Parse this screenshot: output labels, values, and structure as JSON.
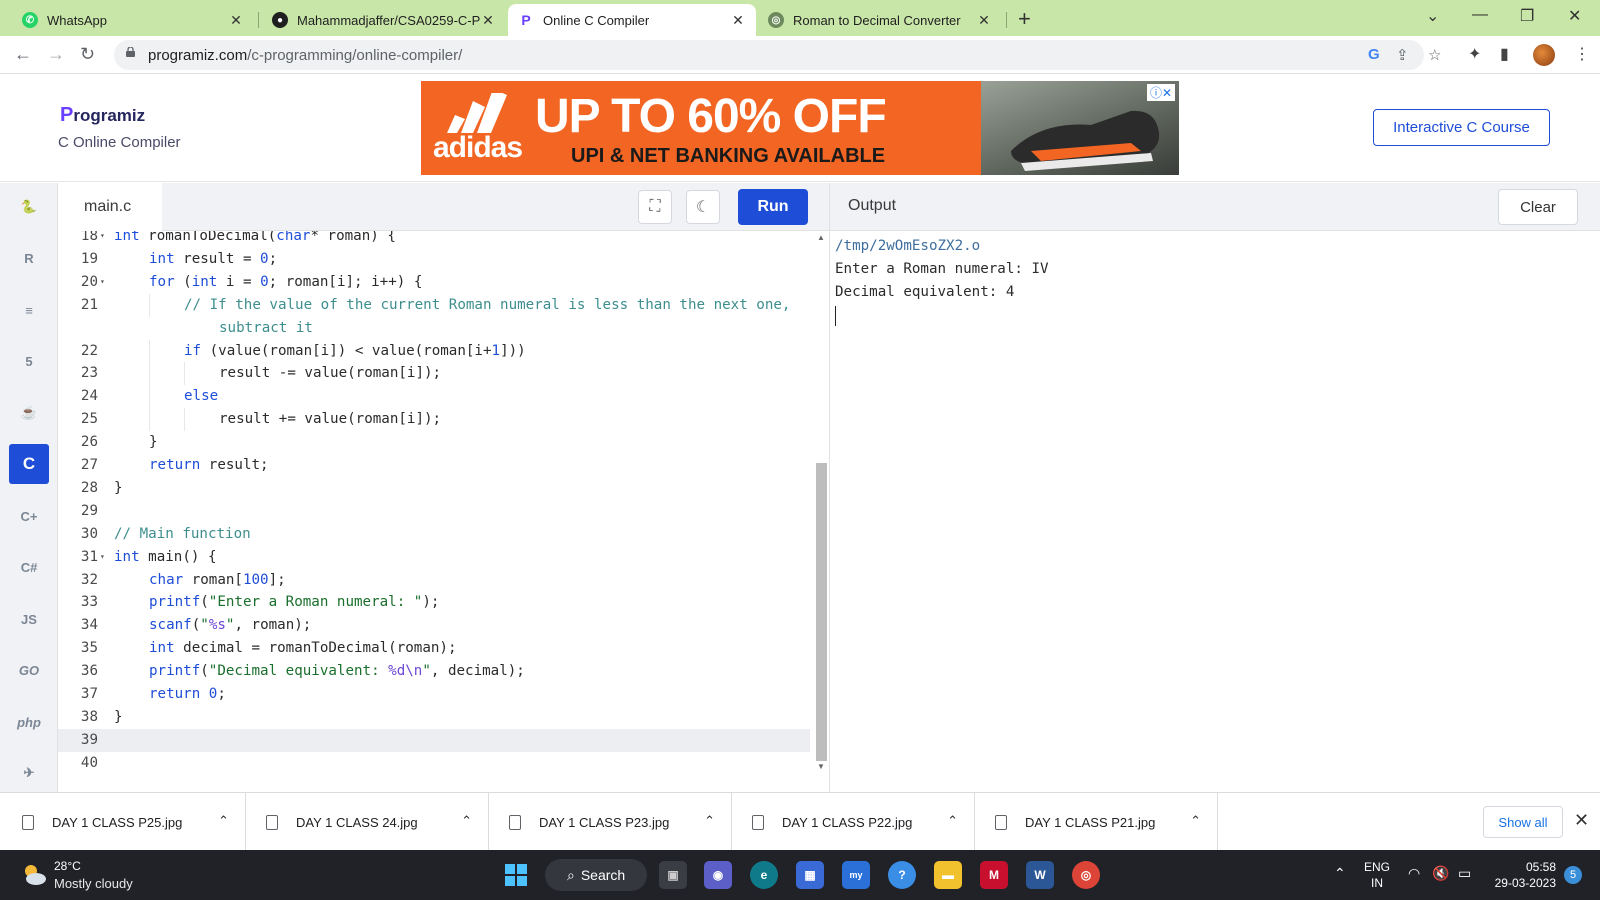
{
  "browser": {
    "tabs": [
      {
        "label": "WhatsApp",
        "icon": "whatsapp-icon",
        "color": "#25d366"
      },
      {
        "label": "Mahammadjaffer/CSA0259-C-PR",
        "icon": "github-icon",
        "color": "#1f1f1f"
      },
      {
        "label": "Online C Compiler",
        "icon": "programiz-icon",
        "color": "#6a3fff"
      },
      {
        "label": "Roman to Decimal Converter",
        "icon": "globe-icon",
        "color": "#6c8a5c"
      }
    ],
    "url_host": "programiz.com",
    "url_path": "/c-programming/online-compiler/"
  },
  "site": {
    "logo_text": "rogramiz",
    "logo_p": "P",
    "subtitle": "C Online Compiler",
    "course_button": "Interactive C Course",
    "ad": {
      "brand": "adidas",
      "headline": "UP TO 60% OFF",
      "subline": "UPI & NET BANKING AVAILABLE",
      "badge": "ⓘ✕",
      "color": "#f26522"
    }
  },
  "sidebar": {
    "items": [
      {
        "icon": "python-icon",
        "label": "🐍"
      },
      {
        "icon": "r-icon",
        "label": "R"
      },
      {
        "icon": "sql-icon",
        "label": "≡"
      },
      {
        "icon": "html5-icon",
        "label": "5"
      },
      {
        "icon": "java-icon",
        "label": "☕"
      },
      {
        "icon": "c-icon",
        "label": "C"
      },
      {
        "icon": "cpp-icon",
        "label": "C+"
      },
      {
        "icon": "csharp-icon",
        "label": "C#"
      },
      {
        "icon": "js-icon",
        "label": "JS"
      },
      {
        "icon": "go-icon",
        "label": "GO"
      },
      {
        "icon": "php-icon",
        "label": "php"
      },
      {
        "icon": "swift-icon",
        "label": "✈"
      }
    ]
  },
  "editor": {
    "filename": "main.c",
    "run_label": "Run",
    "lines": [
      {
        "n": "18",
        "fold": true,
        "indent": 0,
        "html": "<span class='ty'>int</span> romanToDecimal(<span class='ty'>char</span>* roman) {"
      },
      {
        "n": "19",
        "fold": false,
        "indent": 1,
        "html": "<span class='ty'>int</span> result = <span class='num'>0</span>;"
      },
      {
        "n": "20",
        "fold": true,
        "indent": 1,
        "html": "<span class='kw'>for</span> (<span class='ty'>int</span> i = <span class='num'>0</span>; roman[i]; i++) {"
      },
      {
        "n": "21",
        "fold": false,
        "indent": 2,
        "html": "<span class='cm'>// If the value of the current Roman numeral is less than the next one,</span>"
      },
      {
        "n": "",
        "fold": false,
        "indent": 3,
        "html": "<span class='cm'>subtract it</span>"
      },
      {
        "n": "22",
        "fold": false,
        "indent": 2,
        "html": "<span class='kw'>if</span> (value(roman[i]) < value(roman[i+<span class='num'>1</span>]))"
      },
      {
        "n": "23",
        "fold": false,
        "indent": 3,
        "html": "result -= value(roman[i]);"
      },
      {
        "n": "24",
        "fold": false,
        "indent": 2,
        "html": "<span class='kw'>else</span>"
      },
      {
        "n": "25",
        "fold": false,
        "indent": 3,
        "html": "result += value(roman[i]);"
      },
      {
        "n": "26",
        "fold": false,
        "indent": 1,
        "html": "}"
      },
      {
        "n": "27",
        "fold": false,
        "indent": 1,
        "html": "<span class='kw'>return</span> result;"
      },
      {
        "n": "28",
        "fold": false,
        "indent": 0,
        "html": "}"
      },
      {
        "n": "29",
        "fold": false,
        "indent": 0,
        "html": ""
      },
      {
        "n": "30",
        "fold": false,
        "indent": 0,
        "html": "<span class='cm'>// Main function</span>"
      },
      {
        "n": "31",
        "fold": true,
        "indent": 0,
        "html": "<span class='ty'>int</span> main() {"
      },
      {
        "n": "32",
        "fold": false,
        "indent": 1,
        "html": "<span class='ty'>char</span> roman[<span class='num'>100</span>];"
      },
      {
        "n": "33",
        "fold": false,
        "indent": 1,
        "html": "<span class='kw'>printf</span>(<span class='str'>\"Enter a Roman numeral: \"</span>);"
      },
      {
        "n": "34",
        "fold": false,
        "indent": 1,
        "html": "<span class='kw'>scanf</span>(<span class='str'>\"</span><span class='fmt'>%s</span><span class='str'>\"</span>, roman);"
      },
      {
        "n": "35",
        "fold": false,
        "indent": 1,
        "html": "<span class='ty'>int</span> decimal = romanToDecimal(roman);"
      },
      {
        "n": "36",
        "fold": false,
        "indent": 1,
        "html": "<span class='kw'>printf</span>(<span class='str'>\"Decimal equivalent: </span><span class='fmt'>%d\\n</span><span class='str'>\"</span>, decimal);"
      },
      {
        "n": "37",
        "fold": false,
        "indent": 1,
        "html": "<span class='kw'>return</span> <span class='num'>0</span>;"
      },
      {
        "n": "38",
        "fold": false,
        "indent": 0,
        "html": "}"
      },
      {
        "n": "39",
        "fold": false,
        "indent": 0,
        "html": "",
        "current": true
      },
      {
        "n": "40",
        "fold": false,
        "indent": 0,
        "html": ""
      }
    ]
  },
  "output": {
    "title": "Output",
    "clear_label": "Clear",
    "lines": [
      "/tmp/2wOmEsoZX2.o",
      "Enter a Roman numeral: IV",
      "Decimal equivalent: 4"
    ]
  },
  "downloads": {
    "files": [
      "DAY 1 CLASS P25.jpg",
      "DAY 1 CLASS 24.jpg",
      "DAY 1 CLASS P23.jpg",
      "DAY 1 CLASS P22.jpg",
      "DAY 1 CLASS P21.jpg"
    ],
    "show_all": "Show all"
  },
  "taskbar": {
    "temperature": "28°C",
    "condition": "Mostly cloudy",
    "search": "Search",
    "lang": "ENG",
    "region": "IN",
    "time": "05:58",
    "date": "29-03-2023",
    "notifications": "5"
  }
}
